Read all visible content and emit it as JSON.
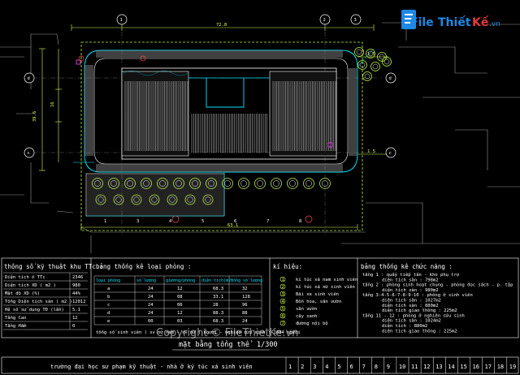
{
  "logo": {
    "file": "File",
    "thiet": "Thiết",
    "ke": "Kế",
    "vn": ".vn"
  },
  "plan": {
    "dims": {
      "top": "72.8",
      "left_v": "39.6",
      "left_v2": "16",
      "bottom": "63.1",
      "right_1": "1.5",
      "right_2": "1.5"
    },
    "axes": {
      "top_1": "1",
      "top_2": "2",
      "top_3": "3",
      "side_d": "d",
      "side_c": "c",
      "side_b": "b"
    },
    "numbers_bottom": [
      "1",
      "3",
      "4",
      "5",
      "6",
      "7",
      "8"
    ]
  },
  "table1": {
    "title": "thông số kỹ thuật khu TTc :",
    "rows": [
      [
        "Diện tích ô TTc",
        "2346"
      ],
      [
        "Diện tích XD ( m2 )",
        "980"
      ],
      [
        "Mật độ XD (%)",
        "44%"
      ],
      [
        "Tổng Diện tích sàn ( m2 )",
        "12012"
      ],
      [
        "Hệ số sử dụng TĐ (lần)",
        "5.1"
      ],
      [
        "Tầng Cao",
        "12"
      ],
      [
        "Tầng Hầm",
        "0"
      ]
    ]
  },
  "table2": {
    "title": "bảng thống kê loại phòng :",
    "headers": [
      "loại phòng",
      "số lượng",
      "giường/phòng",
      "diện tích(m2)",
      "tổng số lượng"
    ],
    "rows": [
      [
        "a",
        "24",
        "12",
        "68.3",
        "32"
      ],
      [
        "b",
        "24",
        "08",
        "33.1",
        "128"
      ],
      [
        "c",
        "24",
        "06",
        "28",
        "96"
      ],
      [
        "d",
        "24",
        "12",
        "88.3",
        "88"
      ],
      [
        "e",
        "00",
        "03",
        "68.3",
        "24"
      ]
    ],
    "footer": "tổng số sinh viên ( sv nữ nam - sv nữ ) người - nghiên cứu sinh : 1084 người"
  },
  "legend": {
    "title": "kí hiệu:",
    "items": [
      "kí túc xá nam sinh viên",
      "kí túc xá nữ sinh viên",
      "Bãi xe sinh viên",
      "Bồn hoa, sân vườn",
      "sân vườn",
      "cây xanh",
      "đường nội bộ"
    ]
  },
  "functions": {
    "title": "bảng thống kê chức năng :",
    "lines": [
      "tầng 1 : quầy tiếp tân - kho phụ trợ",
      "diện tích sàn : 798m2",
      "tầng 2 : phòng sinh hoạt chung - phòng đọc sách - p. tập",
      "diện tích sàn : 980m2",
      "tầng 3-4-5-6-7-8-9-10 : phòng ở sinh viên",
      "diện tích sàn : 1027m2",
      "diện tích sàn : 880m2",
      "diện tích giao thông : 225m2",
      "tầng 11 - 12 : phòng ở nghiên cứu sinh",
      "diện tích sàn : 1024m2",
      "diện tích : 880m2",
      "diện tích giao thông : 225m2"
    ]
  },
  "drawing_title": {
    "label": "mặt bằng tổng thể",
    "scale": "1/300"
  },
  "title_block": {
    "text": "trường đại học sư phạm kỹ thuật - nhà ở ký túc xá sinh viên",
    "cells": [
      "1",
      "2",
      "3",
      "4",
      "5",
      "6",
      "7",
      "8",
      "9",
      "10",
      "11",
      "12",
      "13",
      "14",
      "15",
      "16",
      "17",
      "18",
      "19"
    ]
  },
  "watermark": "Copyright © FileThietKe.vn",
  "colors": {
    "cyan": "#00e5ff",
    "green": "#b8f040",
    "red": "#ff3b3b",
    "logo_blue": "#1e88e5",
    "logo_red": "#e53935"
  }
}
